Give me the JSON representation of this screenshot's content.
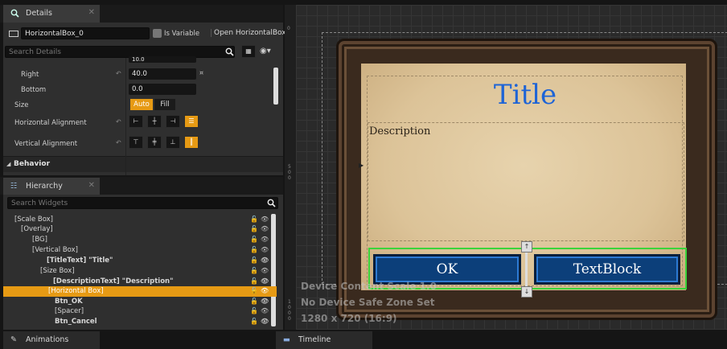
{
  "details": {
    "tab_label": "Details",
    "name_value": "HorizontalBox_0",
    "is_variable_label": "Is Variable",
    "open_link": "Open HorizontalBox",
    "search_placeholder": "Search Details",
    "top_value": "10.0",
    "rows": {
      "right_label": "Right",
      "right_value": "40.0",
      "bottom_label": "Bottom",
      "bottom_value": "0.0",
      "size_label": "Size",
      "size_auto": "Auto",
      "size_fill": "Fill",
      "halign_label": "Horizontal Alignment",
      "valign_label": "Vertical Alignment"
    },
    "behavior_label": "Behavior"
  },
  "hierarchy": {
    "tab_label": "Hierarchy",
    "search_placeholder": "Search Widgets",
    "items": [
      {
        "label": "[Scale Box]"
      },
      {
        "label": "[Overlay]"
      },
      {
        "label": "[BG]"
      },
      {
        "label": "[Vertical Box]"
      },
      {
        "label": "[TitleText] \"Title\""
      },
      {
        "label": "[Size Box]"
      },
      {
        "label": "[DescriptionText] \"Description\""
      },
      {
        "label": "[Horizontal Box]"
      },
      {
        "label": "Btn_OK"
      },
      {
        "label": "[Spacer]"
      },
      {
        "label": "Btn_Cancel"
      }
    ]
  },
  "viewport": {
    "title": "Title",
    "description": "Description",
    "ok_label": "OK",
    "textblock_label": "TextBlock",
    "overlay_line1": "Device Content Scale 1.0",
    "overlay_line2": "No Device Safe Zone Set",
    "overlay_line3": "1280 x 720 (16:9)",
    "ruler_top": "0",
    "ruler_mid": "500",
    "ruler_bottom": "1000"
  },
  "bottom_tabs": {
    "animations": "Animations",
    "timeline": "Timeline"
  },
  "colors": {
    "accent": "#e69a14",
    "title_blue": "#1e64d6",
    "button_blue": "#0c3f7a",
    "selection_green": "#3bd43b"
  }
}
